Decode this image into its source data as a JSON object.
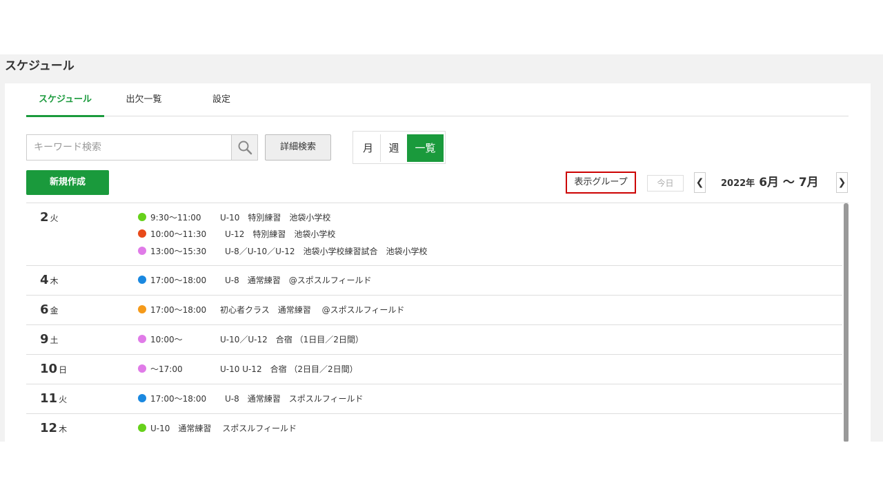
{
  "page_title": "スケジュール",
  "tabs": [
    {
      "label": "スケジュール",
      "active": true
    },
    {
      "label": "出欠一覧",
      "active": false
    },
    {
      "label": "設定",
      "active": false
    }
  ],
  "search": {
    "placeholder": "キーワード検索",
    "value": ""
  },
  "icons": {
    "search": "search-icon",
    "prev": "chevron-left-icon",
    "next": "chevron-right-icon"
  },
  "detail_search_label": "詳細検索",
  "view_modes": [
    {
      "label": "月",
      "active": false
    },
    {
      "label": "週",
      "active": false
    },
    {
      "label": "一覧",
      "active": true
    }
  ],
  "new_button_label": "新規作成",
  "group_button_label": "表示グループ",
  "today_button_label": "今日",
  "date_range": {
    "year": "2022年",
    "months": "6月 〜 7月",
    "prev": "❮",
    "next": "❯"
  },
  "colors": {
    "accent": "#1a9a3c",
    "highlight_border": "#cc0000"
  },
  "days": [
    {
      "day": "2",
      "weekday": "火",
      "events": [
        {
          "color": "#66d11a",
          "time": "9:30〜11:00",
          "desc": "U-10　特別練習　池袋小学校"
        },
        {
          "color": "#e84a1a",
          "time": "10:00〜11:30",
          "desc": "U-12　特別練習　池袋小学校"
        },
        {
          "color": "#e07be8",
          "time": "13:00〜15:30",
          "desc": "U-8／U-10／U-12　池袋小学校練習試合　池袋小学校"
        }
      ]
    },
    {
      "day": "4",
      "weekday": "木",
      "events": [
        {
          "color": "#1a88e0",
          "time": "17:00〜18:00",
          "desc": "U-8　通常練習　@スポスルフィールド"
        }
      ]
    },
    {
      "day": "6",
      "weekday": "金",
      "events": [
        {
          "color": "#f59a1a",
          "time": "17:00〜18:00",
          "desc": "初心者クラス　通常練習　 @スポスルフィールド"
        }
      ]
    },
    {
      "day": "9",
      "weekday": "土",
      "events": [
        {
          "color": "#e07be8",
          "time": "10:00〜",
          "desc": "U-10／U-12　合宿 （1日目／2日間）"
        }
      ]
    },
    {
      "day": "10",
      "weekday": "日",
      "events": [
        {
          "color": "#e07be8",
          "time": "〜17:00",
          "desc": "U-10 U-12　合宿 （2日目／2日間）"
        }
      ]
    },
    {
      "day": "11",
      "weekday": "火",
      "events": [
        {
          "color": "#1a88e0",
          "time": "17:00〜18:00",
          "desc": "U-8　通常練習　スポスルフィールド"
        }
      ]
    },
    {
      "day": "12",
      "weekday": "木",
      "events": [
        {
          "color": "#66d11a",
          "time": "U-10　通常練習　 スポスルフィールド",
          "desc": ""
        }
      ]
    }
  ]
}
